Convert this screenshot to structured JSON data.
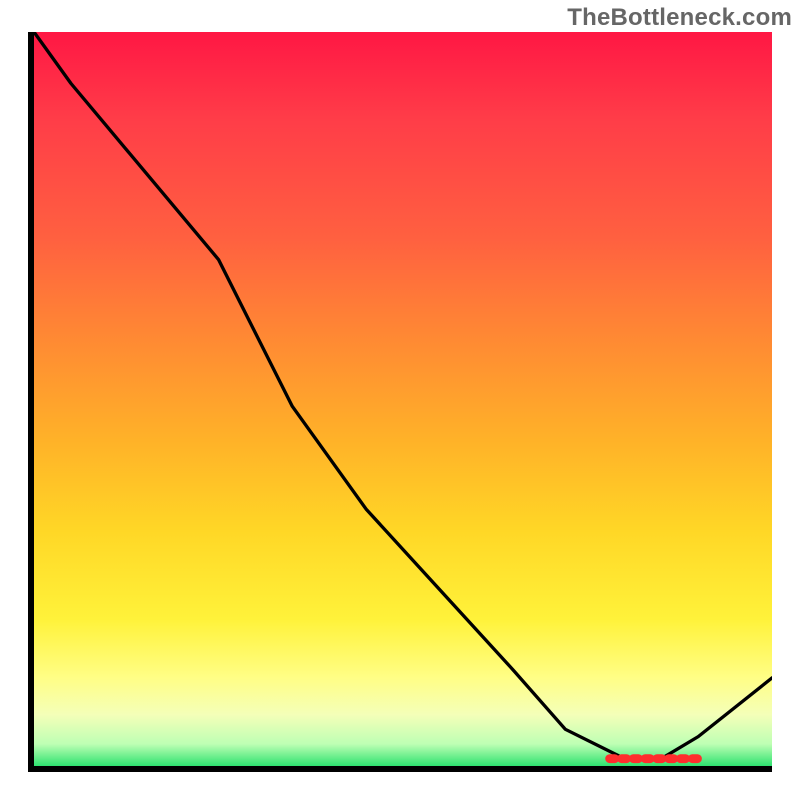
{
  "watermark": "TheBottleneck.com",
  "chart_data": {
    "type": "line",
    "title": "",
    "xlabel": "",
    "ylabel": "",
    "xlim": [
      0,
      100
    ],
    "ylim": [
      0,
      100
    ],
    "grid": false,
    "legend": false,
    "series": [
      {
        "name": "curve",
        "x": [
          0,
          5,
          15,
          25,
          35,
          45,
          55,
          65,
          72,
          80,
          85,
          90,
          100
        ],
        "y": [
          100,
          93,
          81,
          69,
          49,
          35,
          24,
          13,
          5,
          1,
          1,
          4,
          12
        ]
      }
    ],
    "annotation_segment": {
      "name": "highlight",
      "color": "#ff2d2d",
      "x_start": 78,
      "x_end": 90,
      "y": 1
    },
    "gradient_stops": [
      {
        "pos": 0.0,
        "color": "#ff1744"
      },
      {
        "pos": 0.12,
        "color": "#ff3d48"
      },
      {
        "pos": 0.28,
        "color": "#ff6040"
      },
      {
        "pos": 0.42,
        "color": "#ff8a33"
      },
      {
        "pos": 0.56,
        "color": "#ffb328"
      },
      {
        "pos": 0.68,
        "color": "#ffd726"
      },
      {
        "pos": 0.8,
        "color": "#fff23a"
      },
      {
        "pos": 0.88,
        "color": "#fffe86"
      },
      {
        "pos": 0.93,
        "color": "#f4ffb8"
      },
      {
        "pos": 0.97,
        "color": "#beffb4"
      },
      {
        "pos": 1.0,
        "color": "#2ee26f"
      }
    ]
  }
}
